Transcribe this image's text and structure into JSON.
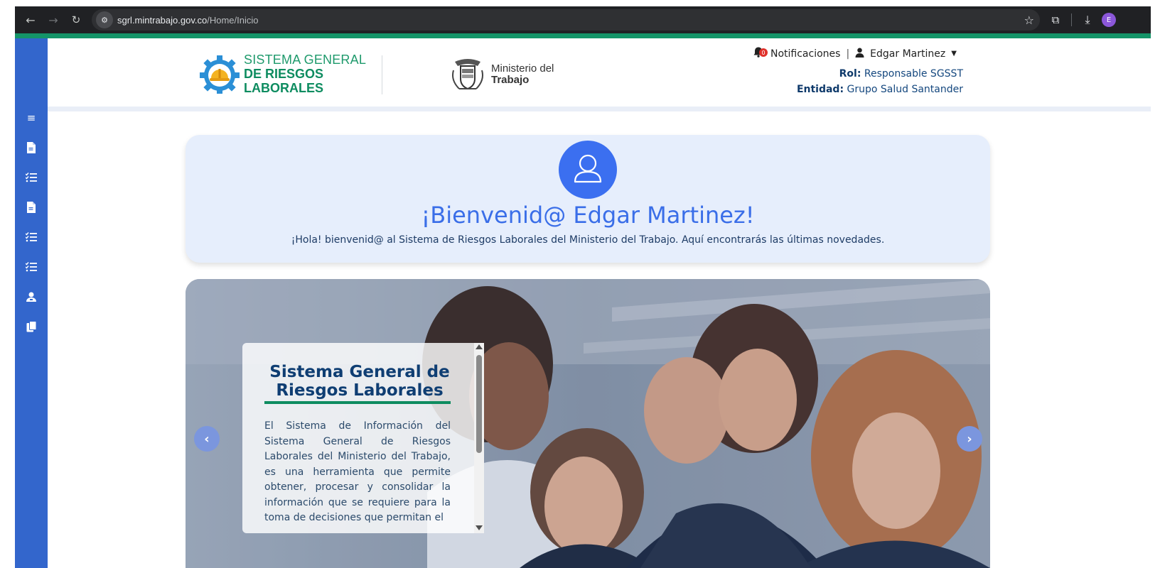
{
  "browser": {
    "url_host": "sgrl.mintrabajo.gov.co",
    "url_path": "/Home/Inicio",
    "profile_initial": "E"
  },
  "logo": {
    "line1": "SISTEMA GENERAL",
    "line2": "DE RIESGOS",
    "line3": "LABORALES"
  },
  "ministry": {
    "line1": "Ministerio del",
    "line2": "Trabajo"
  },
  "user": {
    "notifications_label": "Notificaciones",
    "notifications_count": "0",
    "separator": "|",
    "name": "Edgar Martinez",
    "role_label": "Rol:",
    "role_value": "Responsable SGSST",
    "entity_label": "Entidad:",
    "entity_value": "Grupo Salud Santander"
  },
  "welcome": {
    "title": "¡Bienvenid@ Edgar Martinez!",
    "text": "¡Hola! bienvenid@ al Sistema de Riesgos Laborales del Ministerio del Trabajo. Aquí encontrarás las últimas novedades."
  },
  "carousel": {
    "caption_title": "Sistema General de Riesgos Laborales",
    "caption_body": "El Sistema de Información del Sistema General de Riesgos Laborales del Ministerio del Trabajo, es una herramienta que permite obtener, procesar y consolidar la información que se requiere para la toma de decisiones que permitan el"
  },
  "sidebar": {
    "items": [
      {
        "icon": "menu-icon"
      },
      {
        "icon": "document-icon"
      },
      {
        "icon": "checklist-icon"
      },
      {
        "icon": "document-icon"
      },
      {
        "icon": "checklist-icon"
      },
      {
        "icon": "checklist-icon"
      },
      {
        "icon": "users-icon"
      },
      {
        "icon": "copy-icon"
      }
    ]
  },
  "colors": {
    "sidebar": "#3366cc",
    "accent_green": "#149468",
    "welcome_bg": "#e6eefc",
    "title_blue": "#3a6ee8"
  }
}
